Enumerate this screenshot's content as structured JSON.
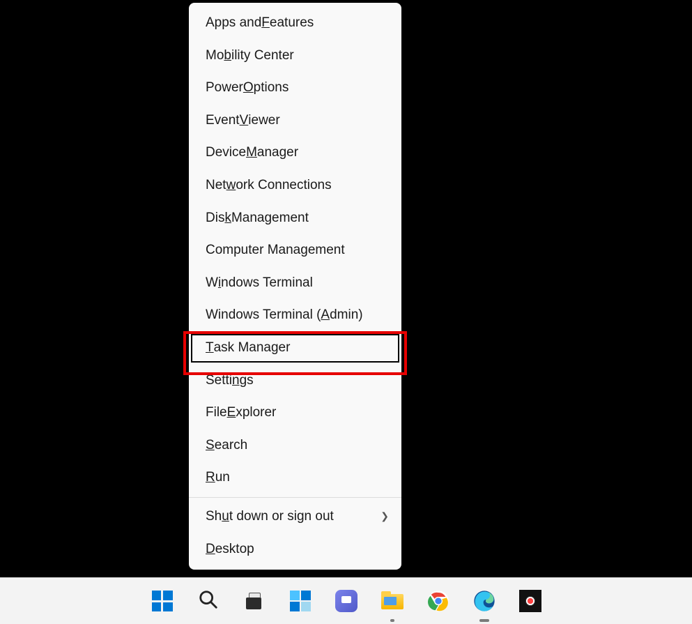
{
  "context_menu": {
    "items": [
      {
        "pre": "Apps and ",
        "accel": "F",
        "post": "eatures",
        "submenu": false
      },
      {
        "pre": "Mo",
        "accel": "b",
        "post": "ility Center",
        "submenu": false
      },
      {
        "pre": "Power ",
        "accel": "O",
        "post": "ptions",
        "submenu": false
      },
      {
        "pre": "Event ",
        "accel": "V",
        "post": "iewer",
        "submenu": false
      },
      {
        "pre": "Device ",
        "accel": "M",
        "post": "anager",
        "submenu": false
      },
      {
        "pre": "Net",
        "accel": "w",
        "post": "ork Connections",
        "submenu": false
      },
      {
        "pre": "Dis",
        "accel": "k",
        "post": " Management",
        "submenu": false
      },
      {
        "pre": "Computer Mana",
        "accel": "g",
        "post": "ement",
        "submenu": false
      },
      {
        "pre": "W",
        "accel": "i",
        "post": "ndows Terminal",
        "submenu": false
      },
      {
        "pre": "Windows Terminal (",
        "accel": "A",
        "post": "dmin)",
        "submenu": false
      },
      {
        "pre": "",
        "accel": "T",
        "post": "ask Manager",
        "submenu": false,
        "focused": true
      },
      {
        "pre": "Setti",
        "accel": "n",
        "post": "gs",
        "submenu": false
      },
      {
        "pre": "File ",
        "accel": "E",
        "post": "xplorer",
        "submenu": false
      },
      {
        "pre": "",
        "accel": "S",
        "post": "earch",
        "submenu": false
      },
      {
        "pre": "",
        "accel": "R",
        "post": "un",
        "submenu": false
      },
      {
        "separator": true
      },
      {
        "pre": "Sh",
        "accel": "u",
        "post": "t down or sign out",
        "submenu": true
      },
      {
        "pre": "",
        "accel": "D",
        "post": "esktop",
        "submenu": false
      }
    ]
  },
  "taskbar": {
    "items": [
      {
        "name": "start-button",
        "icon": "windows-logo-icon"
      },
      {
        "name": "search-button",
        "icon": "search-icon"
      },
      {
        "name": "task-view-button",
        "icon": "task-view-icon"
      },
      {
        "name": "widgets-button",
        "icon": "widgets-icon"
      },
      {
        "name": "chat-button",
        "icon": "chat-icon"
      },
      {
        "name": "file-explorer-button",
        "icon": "file-explorer-icon",
        "running": true
      },
      {
        "name": "chrome-button",
        "icon": "chrome-icon"
      },
      {
        "name": "edge-button",
        "icon": "edge-icon",
        "running": true,
        "alert": true
      },
      {
        "name": "screen-recorder-button",
        "icon": "screen-recorder-icon"
      }
    ]
  },
  "highlight": {
    "target": "task-manager"
  }
}
